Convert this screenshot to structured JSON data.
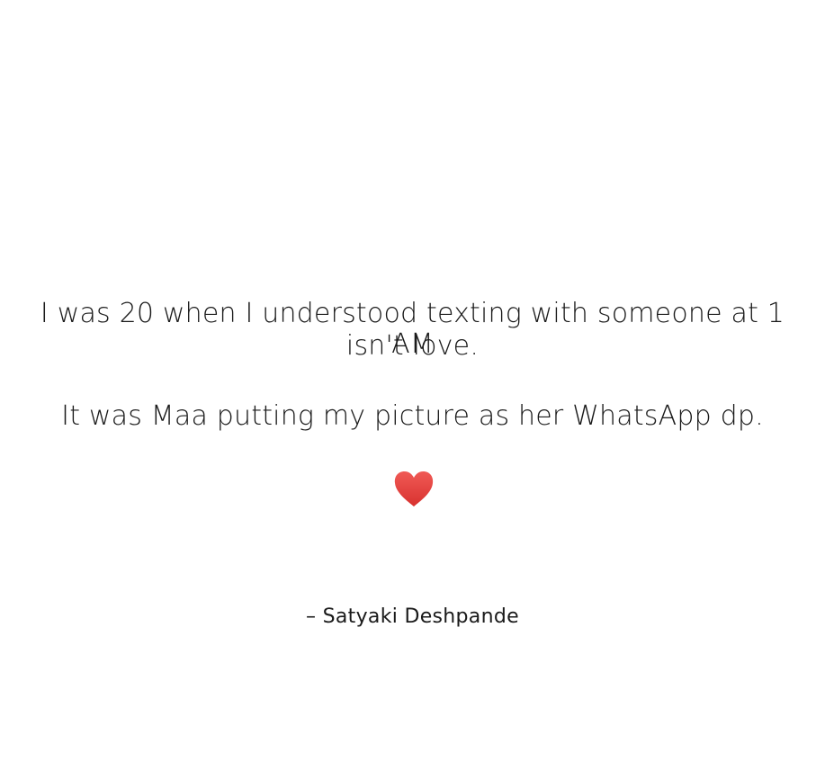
{
  "quote": {
    "line1": "I was 20 when I understood texting with someone at 1 AM",
    "line2": "isn't love.",
    "line3": "It was Maa putting my picture as her WhatsApp dp."
  },
  "heart": {
    "icon": "heart-icon",
    "color": "#e0403f"
  },
  "author": {
    "text": "– Satyaki Deshpande"
  }
}
